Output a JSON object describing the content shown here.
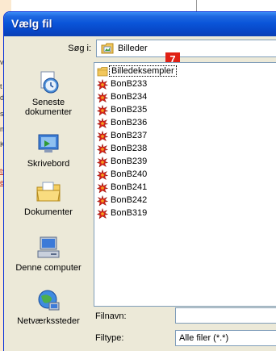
{
  "background": {
    "fragments": [
      "ve",
      "t",
      "de",
      "s",
      "n",
      "K"
    ],
    "link_fragments": [
      "ts",
      "e"
    ]
  },
  "dialog": {
    "title": "Vælg fil"
  },
  "look_in": {
    "label": "Søg i:",
    "value": "Billeder"
  },
  "badge": "7",
  "places": [
    {
      "label": "Seneste dokumenter",
      "icon": "recent-documents-icon"
    },
    {
      "label": "Skrivebord",
      "icon": "desktop-icon"
    },
    {
      "label": "Dokumenter",
      "icon": "my-documents-icon"
    },
    {
      "label": "Denne computer",
      "icon": "my-computer-icon"
    },
    {
      "label": "Netværkssteder",
      "icon": "network-places-icon"
    }
  ],
  "files": [
    {
      "name": "Billedeksempler",
      "type": "folder"
    },
    {
      "name": "BonB233",
      "type": "image"
    },
    {
      "name": "BonB234",
      "type": "image"
    },
    {
      "name": "BonB235",
      "type": "image"
    },
    {
      "name": "BonB236",
      "type": "image"
    },
    {
      "name": "BonB237",
      "type": "image"
    },
    {
      "name": "BonB238",
      "type": "image"
    },
    {
      "name": "BonB239",
      "type": "image"
    },
    {
      "name": "BonB240",
      "type": "image"
    },
    {
      "name": "BonB241",
      "type": "image"
    },
    {
      "name": "BonB242",
      "type": "image"
    },
    {
      "name": "BonB319",
      "type": "image"
    }
  ],
  "filename": {
    "label": "Filnavn:",
    "value": ""
  },
  "filetype": {
    "label": "Filtype:",
    "value": "Alle filer (*.*)"
  },
  "colors": {
    "titlebar": "#0a55d9",
    "dialog_bg": "#ece9d8",
    "badge": "#e02014"
  }
}
